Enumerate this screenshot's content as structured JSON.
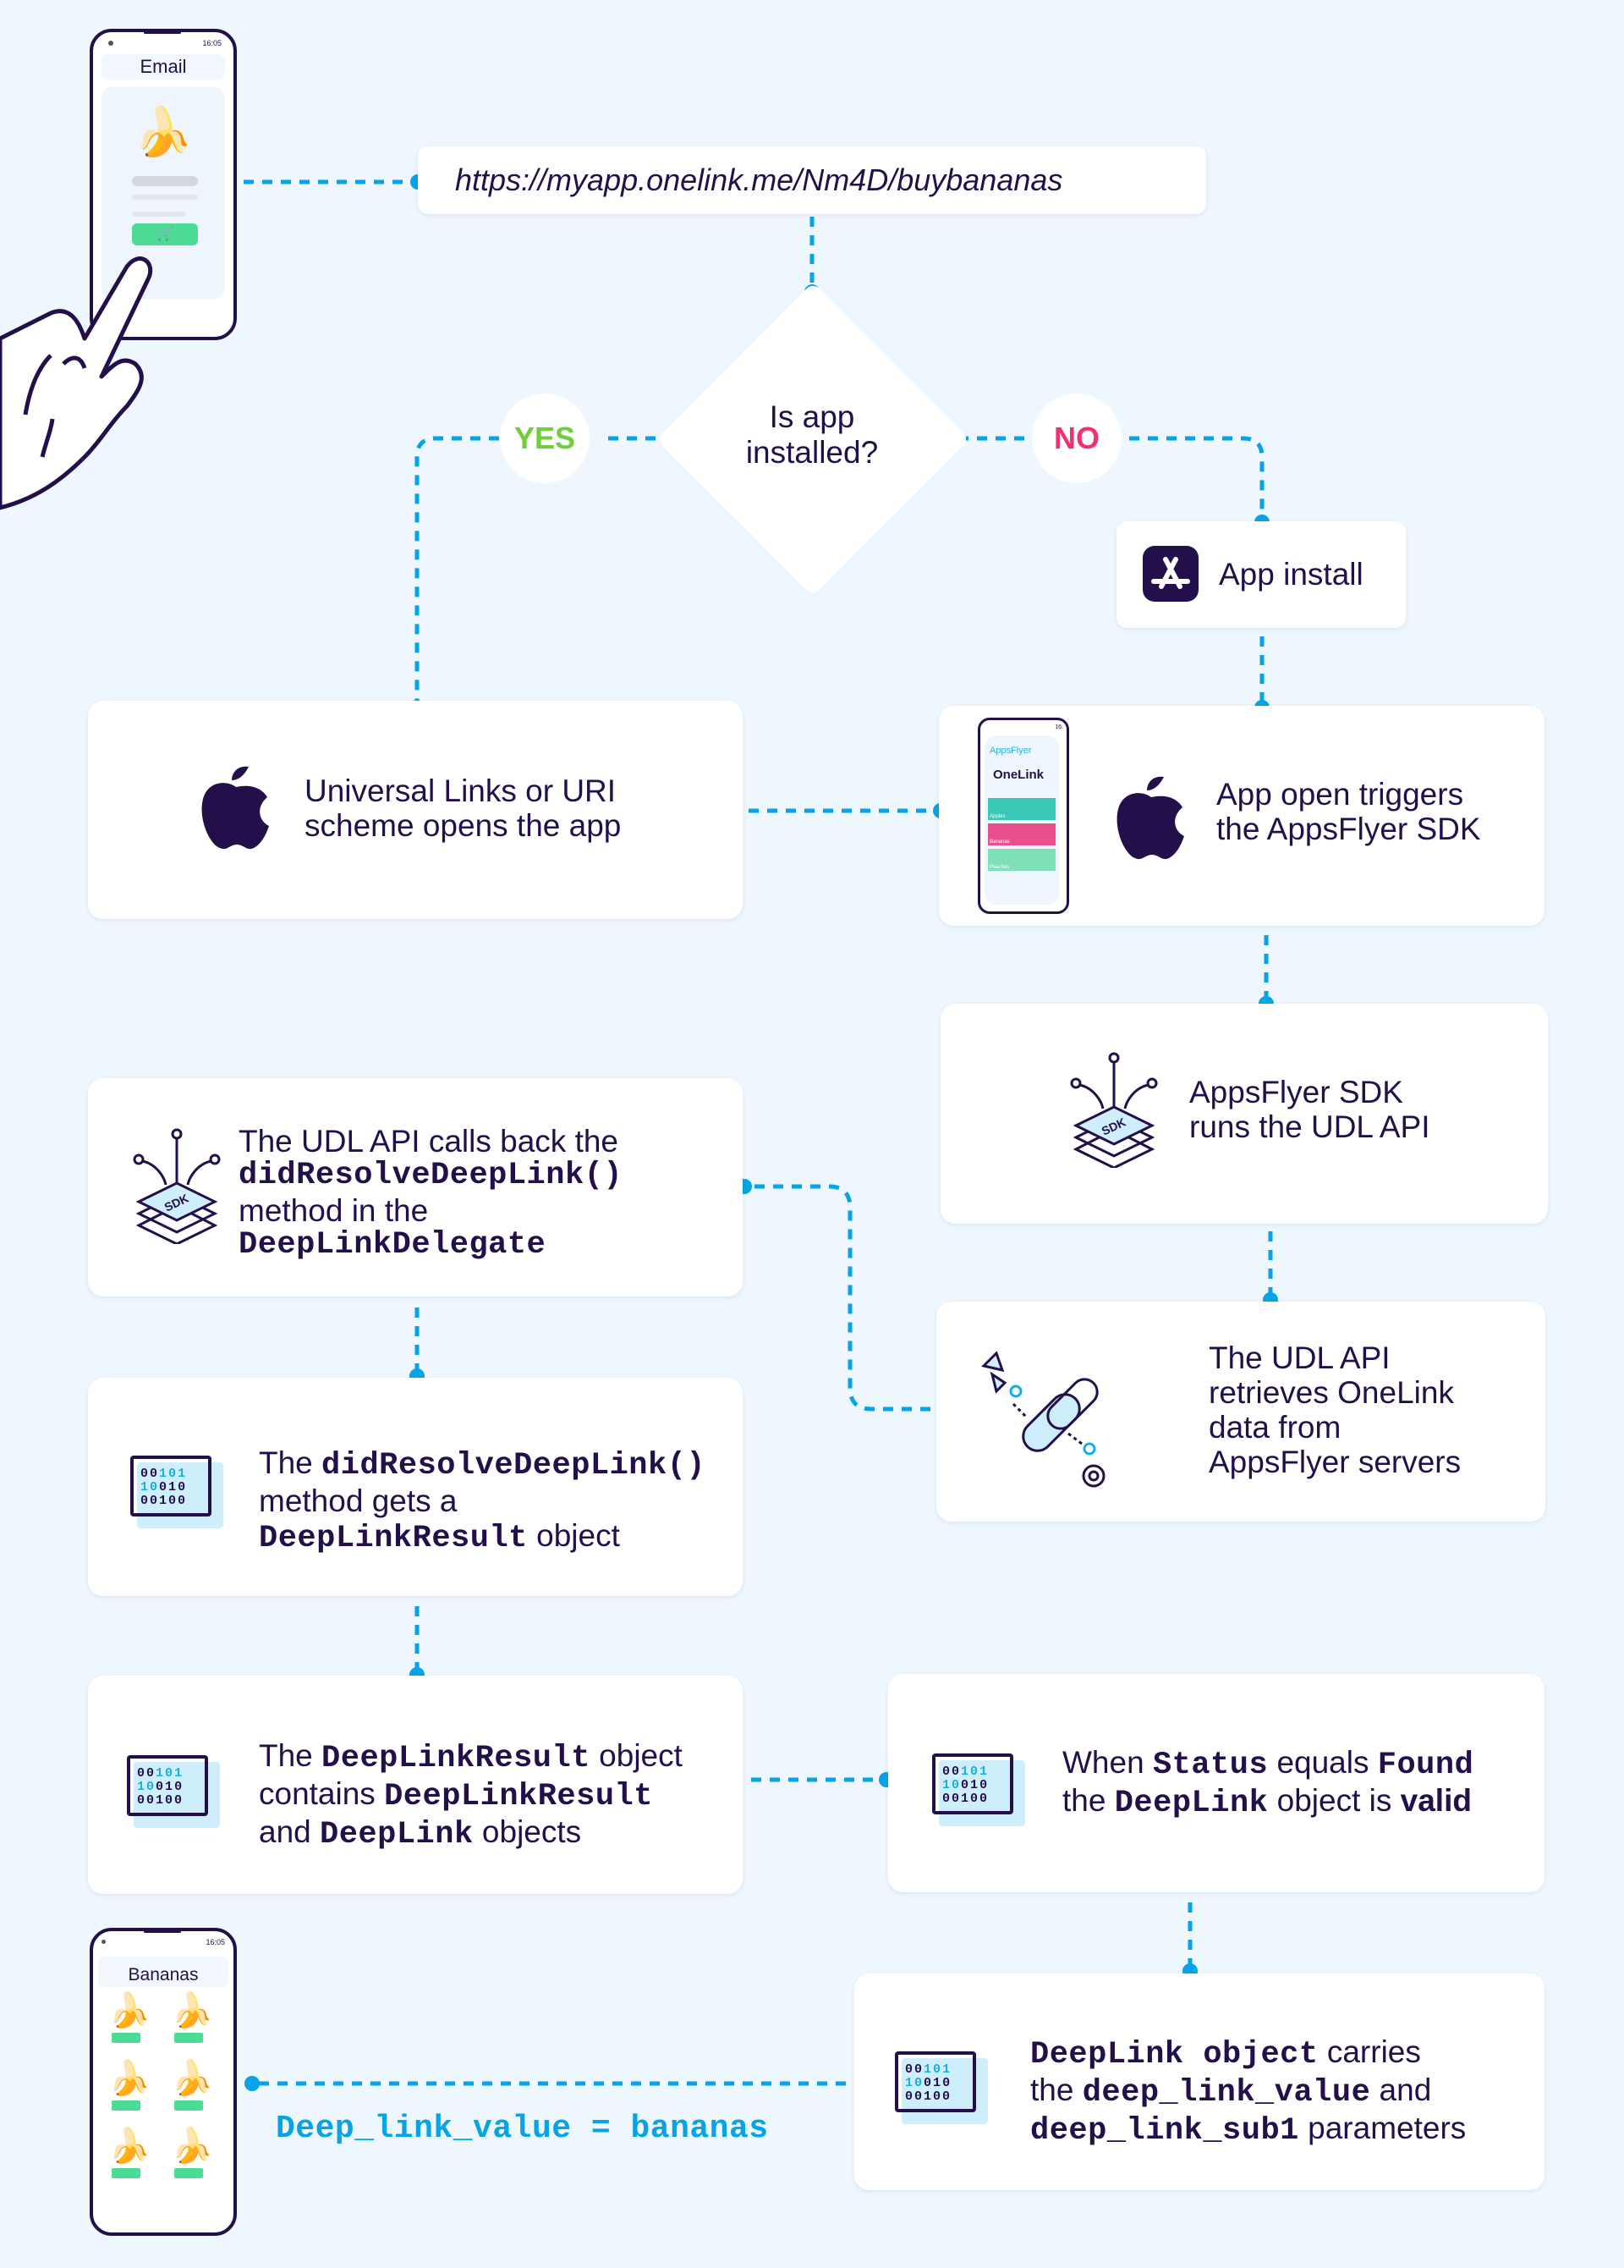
{
  "colors": {
    "background": "#eef6fe",
    "text": "#23104a",
    "connector": "#06a3e6",
    "yes": "#6fcf3b",
    "no": "#f0306f",
    "cart_button": "#4cdc95"
  },
  "email_phone": {
    "status_time": "16:05",
    "title": "Email",
    "product_icon": "banana-icon",
    "cart_icon": "cart-icon"
  },
  "url_box": {
    "text": "https://myapp.onelink.me/Nm4D/buybananas"
  },
  "decision": {
    "line1": "Is app",
    "line2": "installed?",
    "yes_label": "YES",
    "no_label": "NO"
  },
  "app_install": {
    "icon": "app-store-icon",
    "label": "App install"
  },
  "universal_links": {
    "icon": "apple-icon",
    "line1": "Universal Links or URI",
    "line2": "scheme opens the app"
  },
  "app_open": {
    "icon": "apple-icon",
    "line1": "App open triggers",
    "line2": "the AppsFlyer SDK",
    "phone": {
      "status_time": "16:",
      "brand": "AppsFlyer",
      "product": "OneLink",
      "banners": [
        "Apples",
        "Bananas",
        "Peaches"
      ]
    }
  },
  "sdk_runs": {
    "icon": "sdk-icon",
    "icon_label": "SDK",
    "line1": "AppsFlyer SDK",
    "line2": "runs the UDL API"
  },
  "udl_callback": {
    "icon": "sdk-icon",
    "icon_label": "SDK",
    "line1": "The UDL API calls back the",
    "code1": "didResolveDeepLink()",
    "line3": "method in the",
    "code2": "DeepLinkDelegate"
  },
  "udl_retrieves": {
    "icon": "chain-link-icon",
    "line1": "The UDL API",
    "line2": "retrieves OneLink",
    "line3": "data from",
    "line4": "AppsFlyer servers"
  },
  "did_resolve": {
    "icon": "binary-code-icon",
    "pre": "The ",
    "code1": "didResolveDeepLink()",
    "line2": "method gets a",
    "code2": "DeepLinkResult",
    "post": " object"
  },
  "result_contains": {
    "icon": "binary-code-icon",
    "pre": "The ",
    "code1": "DeepLinkResult",
    "post1": " object",
    "pre2": "contains ",
    "code2": "DeepLinkResult",
    "pre3": "and ",
    "code3": "DeepLink",
    "post3": " objects"
  },
  "status_found": {
    "icon": "binary-code-icon",
    "pre": "When ",
    "code1": "Status",
    "mid": " equals ",
    "code2": "Found",
    "pre2": "the ",
    "code3": "DeepLink",
    "mid2": " object is ",
    "bold": "valid"
  },
  "deeplink_carries": {
    "icon": "binary-code-icon",
    "code1": "DeepLink object",
    "post1": " carries",
    "pre2": "the ",
    "code2": "deep_link_value",
    "post2": " and",
    "code3": "deep_link_sub1",
    "post3": " parameters"
  },
  "binary_digits": [
    "00101",
    "10010",
    "00100"
  ],
  "result_label": "Deep_link_value = bananas",
  "bananas_phone": {
    "status_time": "16:05",
    "title": "Bananas",
    "items": 6
  }
}
